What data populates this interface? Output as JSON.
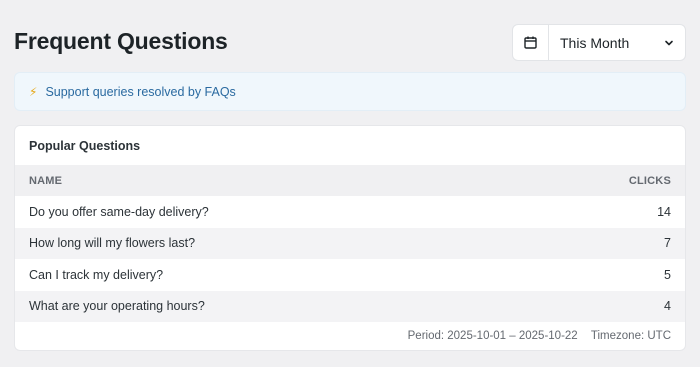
{
  "header": {
    "title": "Frequent Questions",
    "period_select": {
      "selected": "This Month"
    }
  },
  "icons": {
    "calendar": "calendar-icon",
    "chevron": "chevron-down-icon",
    "bolt": "lightning-icon"
  },
  "notice": {
    "icon_glyph": "⚡",
    "text": "Support queries resolved by FAQs"
  },
  "card": {
    "title": "Popular Questions",
    "columns": {
      "name": "Name",
      "clicks": "Clicks"
    },
    "rows": [
      {
        "name": "Do you offer same-day delivery?",
        "clicks": "14"
      },
      {
        "name": "How long will my flowers last?",
        "clicks": "7"
      },
      {
        "name": "Can I track my delivery?",
        "clicks": "5"
      },
      {
        "name": "What are your operating hours?",
        "clicks": "4"
      }
    ],
    "footer": {
      "period": "Period: 2025-10-01 – 2025-10-22",
      "timezone": "Timezone: UTC"
    }
  },
  "colors": {
    "background": "#f0f0f2",
    "notice_bg": "#f0f7fc",
    "notice_text": "#2a6aa0",
    "accent_bolt": "#e6a817"
  }
}
